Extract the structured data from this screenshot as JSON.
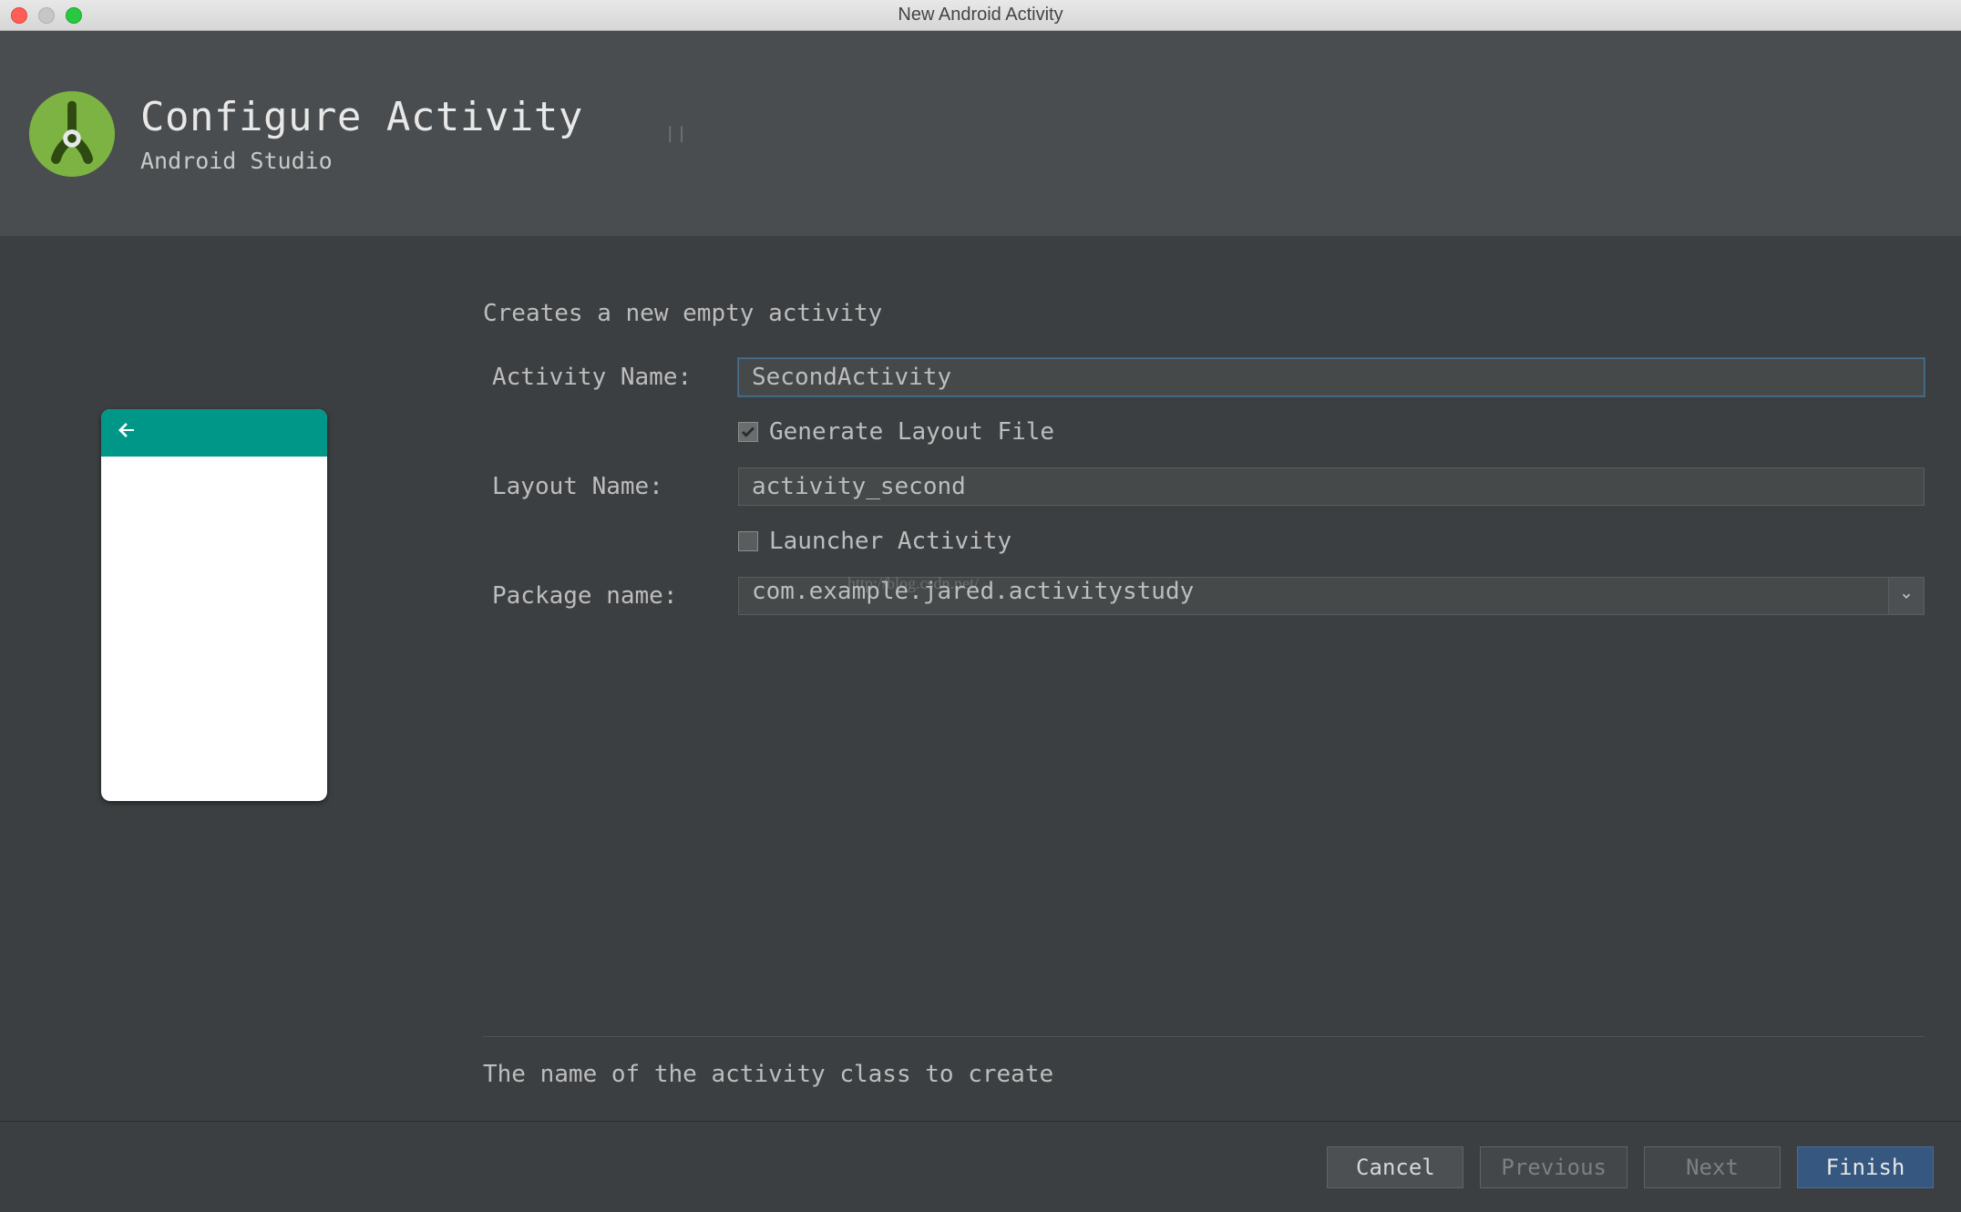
{
  "window": {
    "title": "New Android Activity"
  },
  "header": {
    "title": "Configure Activity",
    "subtitle": "Android Studio"
  },
  "form": {
    "description": "Creates a new empty activity",
    "activity_name_label": "Activity Name:",
    "activity_name_value": "SecondActivity",
    "generate_layout_label": "Generate Layout File",
    "generate_layout_checked": true,
    "layout_name_label": "Layout Name:",
    "layout_name_value": "activity_second",
    "launcher_label": "Launcher Activity",
    "launcher_checked": false,
    "package_label": "Package name:",
    "package_value": "com.example.jared.activitystudy",
    "hint": "The name of the activity class to create"
  },
  "watermark": "http://blog.csdn.net/",
  "footer": {
    "cancel": "Cancel",
    "previous": "Previous",
    "next": "Next",
    "finish": "Finish"
  }
}
